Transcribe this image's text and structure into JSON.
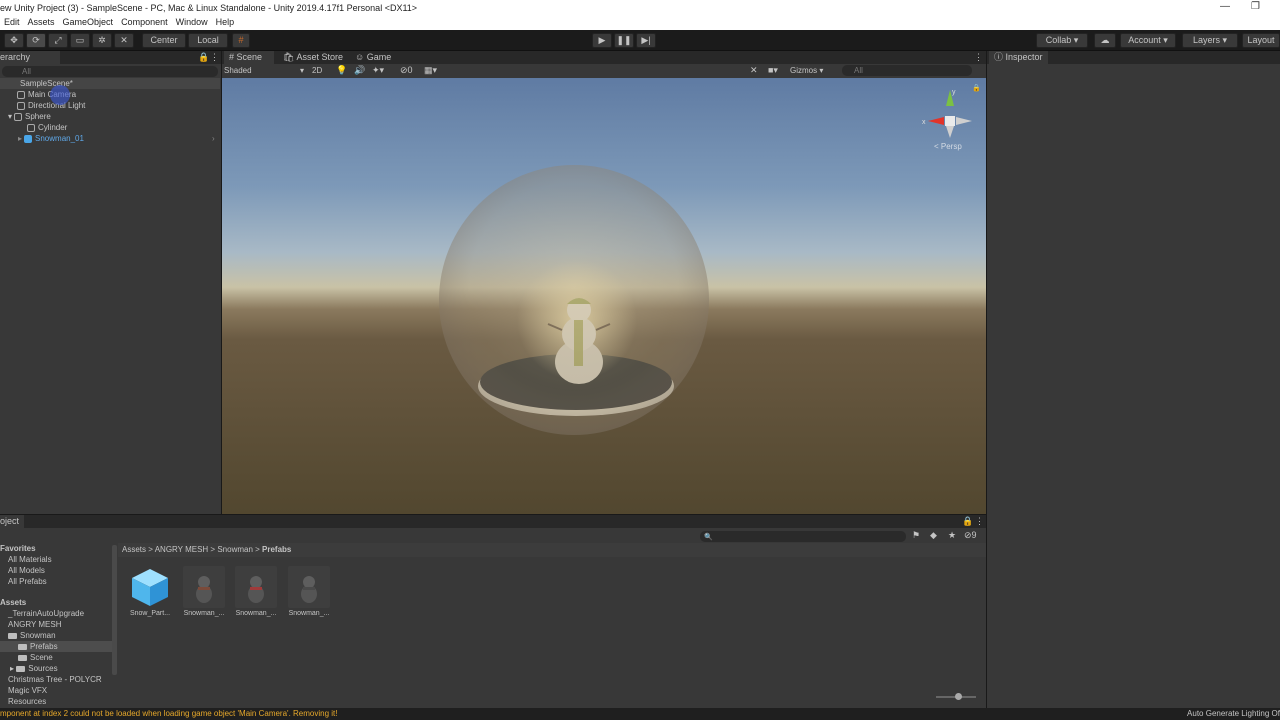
{
  "window": {
    "title": "ew Unity Project (3) - SampleScene - PC, Mac & Linux Standalone - Unity 2019.4.17f1 Personal <DX11>"
  },
  "menu": [
    "Edit",
    "Assets",
    "GameObject",
    "Component",
    "Window",
    "Help"
  ],
  "toolbar": {
    "center": "Center",
    "local": "Local",
    "collab": "Collab ▾",
    "account": "Account",
    "layers": "Layers",
    "layout": "Layout"
  },
  "hierarchy": {
    "title": "erarchy",
    "search_placeholder": "All",
    "scene": "SampleScene*",
    "items": [
      "Main Camera",
      "Directional Light",
      "Sphere",
      "Cylinder",
      "Snowman_01"
    ]
  },
  "sceneView": {
    "tabs": [
      "Scene",
      "Asset Store",
      "Game"
    ],
    "shading": "Shaded",
    "mode2d": "2D",
    "fx_count": "0",
    "gizmos": "Gizmos",
    "search_placeholder": "All",
    "persp": "< Persp"
  },
  "inspector": {
    "title": "Inspector"
  },
  "project": {
    "title": "oject",
    "favorites": "Favorites",
    "fav_items": [
      "All Materials",
      "All Models",
      "All Prefabs"
    ],
    "assets": "Assets",
    "tree": [
      "_TerrainAutoUpgrade",
      "ANGRY MESH",
      "Snowman",
      "Prefabs",
      "Scene",
      "Sources",
      "Christmas Tree - POLYCR",
      "Magic VFX",
      "Resources"
    ],
    "breadcrumb": [
      "Assets",
      "ANGRY MESH",
      "Snowman",
      "Prefabs"
    ],
    "hidden_count": "9",
    "files": [
      "Snow_Part...",
      "Snowman_...",
      "Snowman_...",
      "Snowman_..."
    ]
  },
  "status": {
    "message": "mponent at index 2 could not be loaded when loading game object 'Main Camera'. Removing it!",
    "right": "Auto Generate Lighting Of"
  }
}
